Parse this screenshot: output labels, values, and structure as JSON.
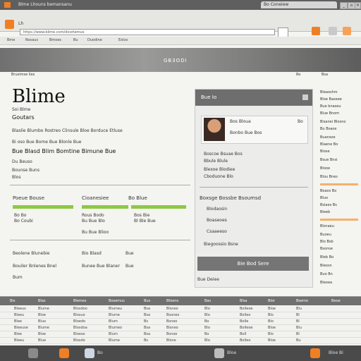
{
  "titlebar": {
    "title": "Blme Lhouns bemansanu",
    "tab_label": "Bo Coneiew",
    "buttons": [
      "_",
      "▫",
      "×"
    ]
  },
  "toolbar": {
    "logo_icon": "app-logo-icon",
    "menu_label": "Lh",
    "url": "https://www.blime.com/dicohemus",
    "go_icon": "folder-icon"
  },
  "bookmarks": [
    "Bme",
    "Roxaus",
    "Bmoes",
    "Bu",
    "Duodine",
    "Exlos"
  ],
  "banner": {
    "brand": "GB3ODI"
  },
  "subnav": {
    "left": "Brusimse lles",
    "right": [
      "Ro",
      "Bsa"
    ]
  },
  "main": {
    "title": "Blime",
    "subtitle": "Soi Blme",
    "tagline": "Goutars",
    "lines": [
      "Blaslie Blumbo Rostreo Clinsule Bloe Borduce Etluse",
      "Bi oso Bue Bome Bue Blonle Bue",
      "Bue Blasd Blim Bomtine Bimune Bue"
    ],
    "meta": [
      "Du Beuso",
      "Bounse Buns",
      "Blos"
    ],
    "cols": [
      {
        "head": "Poeue Bouse",
        "vals": [
          "Bo Bo",
          "Bo Coubi"
        ]
      },
      {
        "head": "Cioanesiee",
        "vals": [
          "Rous Bodo",
          "Bu Bue Blo",
          "Bu Bue Blioo"
        ]
      },
      {
        "head": "Bo Blue",
        "vals": [
          "Bos Bie",
          "Bl Ble Bue"
        ]
      }
    ],
    "footer_rows": [
      [
        "Beolene Blunebie",
        "Bio Blasd",
        "Bue"
      ],
      [
        "Bouiler Bnlenes Bnel",
        "Bunee Bue Blaner",
        "Bue"
      ],
      [
        "Bum"
      ]
    ]
  },
  "card": {
    "header": "Bue Io",
    "profile_name": "Bos Bloua",
    "profile_sub": "Bonbo Bue Bos",
    "profile_count": "Bo",
    "list_title": "Boscoe Bsuae Bos",
    "list": [
      "Bbule Blule",
      "Blexoe Blodiee",
      "Cboduone Blo"
    ],
    "section": "Boxsge Bossbe Bsoumsd",
    "items": [
      "Blodaosin",
      "Boaseoes",
      "Csaaeeso"
    ],
    "footer_link": "Biegoossio Bsne",
    "button": "Bie Bod Sere",
    "under_button": "Bue Deiee"
  },
  "sidebar": {
    "items": [
      "Bleaoshm",
      "Bloe Baseee",
      "Bue bnaseu",
      "Blue Bnom",
      "Bisanei Blosno",
      "Bu Bsaoe",
      "Buansoe",
      "Blaene Bo",
      "Blose",
      "Bsue Bnsi",
      "Blooe",
      "Blou Bnes",
      "Boaos Bo",
      "Bluo",
      "Bsiaes Bs",
      "Bleeb",
      "Blsnaeu",
      "Buoeu",
      "Blo Bsb",
      "Bsonse",
      "Bleb Bo",
      "Bleosn",
      "Buo Bn",
      "Bleoea"
    ]
  },
  "table": {
    "headers": [
      "Bis",
      "Blas",
      "Blemes",
      "Bosemus",
      "Bus",
      "Bfoens",
      "Bas",
      "Blsa",
      "Blor",
      "Bsemo",
      "Beoe"
    ],
    "rows": [
      [
        "Bleeus",
        "Blume",
        "Blosdoo",
        "Blumeu",
        "Bsa",
        "Blsneo",
        "Blo",
        "Bolleoe",
        "Bloe",
        "Blu"
      ],
      [
        "Bleeu",
        "Bloe",
        "Blosuo",
        "Blume",
        "Bsa",
        "Bsoneo",
        "Blo",
        "Bolleo",
        "Blo",
        "Bl"
      ],
      [
        "Blee",
        "Bluo",
        "Bloedo",
        "Blum",
        "Bs",
        "Bsneo",
        "Bo",
        "Bolle",
        "Blo",
        "Bl"
      ],
      [
        "Bleeuse",
        "Blume",
        "Blosdoa",
        "Blumeo",
        "Bsa",
        "Blsneo",
        "Blo",
        "Bolleoe",
        "Bloe",
        "Blu"
      ],
      [
        "Blee",
        "Bloe",
        "Bloeso",
        "Blum",
        "Bsa",
        "Bsnoe",
        "Bo",
        "Boll",
        "Blo",
        "Bl"
      ],
      [
        "Bleeu",
        "Blue",
        "Blosdo",
        "Blume",
        "Bs",
        "Blsne",
        "Blo",
        "Bolleo",
        "Bloe",
        "Bu"
      ]
    ]
  },
  "taskbar": {
    "labels": [
      "Bo",
      "Bloe"
    ],
    "clock": "Bloe Bi"
  },
  "colors": {
    "accent": "#f07f24",
    "green": "#8fc844",
    "header": "#707070",
    "orange_bar": "#f3b16a"
  }
}
